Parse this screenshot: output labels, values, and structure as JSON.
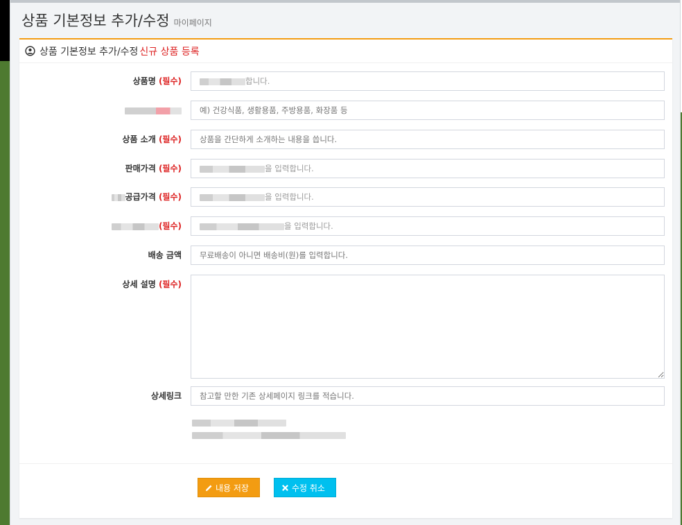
{
  "page": {
    "title": "상품 기본정보 추가/수정",
    "subtitle": "마이페이지"
  },
  "panel": {
    "heading": "상품 기본정보 추가/수정",
    "heading_accent": "신규 상품 등록",
    "heading_icon": "user-circle-icon",
    "accent_color": "#f39c12"
  },
  "form": {
    "required_mark": "(필수)",
    "fields": [
      {
        "label": "상품명",
        "required": true,
        "placeholder_tail": "합니다."
      },
      {
        "label": "",
        "required": false,
        "placeholder": "예) 건강식품, 생활용품, 주방용품, 화장품 등"
      },
      {
        "label": "상품 소개",
        "required": true,
        "placeholder": "상품을 간단하게 소개하는 내용을 씁니다."
      },
      {
        "label": "판매가격",
        "required": true,
        "placeholder_tail": "을 입력합니다."
      },
      {
        "label": "공급가격",
        "required": true,
        "placeholder_tail": "을 입력합니다."
      },
      {
        "label": "",
        "required": true,
        "placeholder_tail": "을 입력합니다."
      },
      {
        "label": "배송 금액",
        "required": false,
        "placeholder": "무료배송이 아니면 배송비(원)를 입력합니다."
      },
      {
        "label": "상세 설명",
        "required": true,
        "placeholder": ""
      },
      {
        "label": "상세링크",
        "required": false,
        "placeholder": "참고할 만한 기존 상세페이지 링크를 적습니다."
      }
    ]
  },
  "buttons": {
    "save": "내용 저장",
    "save_icon": "pencil-icon",
    "cancel": "수정 취소",
    "cancel_icon": "close-icon",
    "save_color": "#f39c12",
    "cancel_color": "#00c0ef"
  }
}
